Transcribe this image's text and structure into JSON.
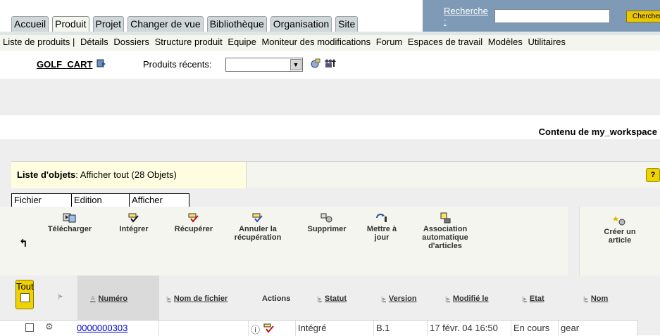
{
  "top_tabs": [
    {
      "label": "Accueil"
    },
    {
      "label": "Produit"
    },
    {
      "label": "Projet"
    },
    {
      "label": "Changer de vue"
    },
    {
      "label": "Bibliothèque"
    },
    {
      "label": "Organisation"
    },
    {
      "label": "Site"
    }
  ],
  "search": {
    "label": "Recherche :",
    "value": "",
    "button": "Chercher"
  },
  "subnav": [
    "Liste de produits |",
    "Détails",
    "Dossiers",
    "Structure produit",
    "Equipe",
    "Moniteur des modifications",
    "Forum",
    "Espaces de travail",
    "Modèles",
    "Utilitaires"
  ],
  "context": {
    "product": "GOLF_CART",
    "recent_label": "Produits récents:",
    "recent_value": ""
  },
  "workspace_title": "Contenu de my_workspace",
  "list": {
    "title_bold": "Liste d'objets",
    "title_rest": ": Afficher tout (28 Objets)",
    "help": "?"
  },
  "menu": [
    "Fichier",
    "Edition",
    "Afficher"
  ],
  "toolbar": {
    "download": "Télécharger",
    "checkin": "Intégrer",
    "checkout": "Récupérer",
    "undo_checkout_1": "Annuler la",
    "undo_checkout_2": "récupération",
    "delete": "Supprimer",
    "update_1": "Mettre à",
    "update_2": "jour",
    "assoc_1": "Association",
    "assoc_2": "automatique",
    "assoc_3": "d'articles",
    "create_1": "Créer un",
    "create_2": "article"
  },
  "table": {
    "select_all": "Tout",
    "headers": {
      "numero": "Numéro",
      "filename": "Nom de fichier",
      "actions": "Actions",
      "statut": "Statut",
      "version": "Version",
      "modified": "Modifié le",
      "etat": "Etat",
      "nom": "Nom"
    },
    "rows": [
      {
        "numero": "0000000303",
        "filename": "",
        "statut": "Intégré",
        "version": "B.1",
        "modified": "17 févr. 04 16:50",
        "etat": "En cours",
        "nom": "gear"
      }
    ]
  }
}
